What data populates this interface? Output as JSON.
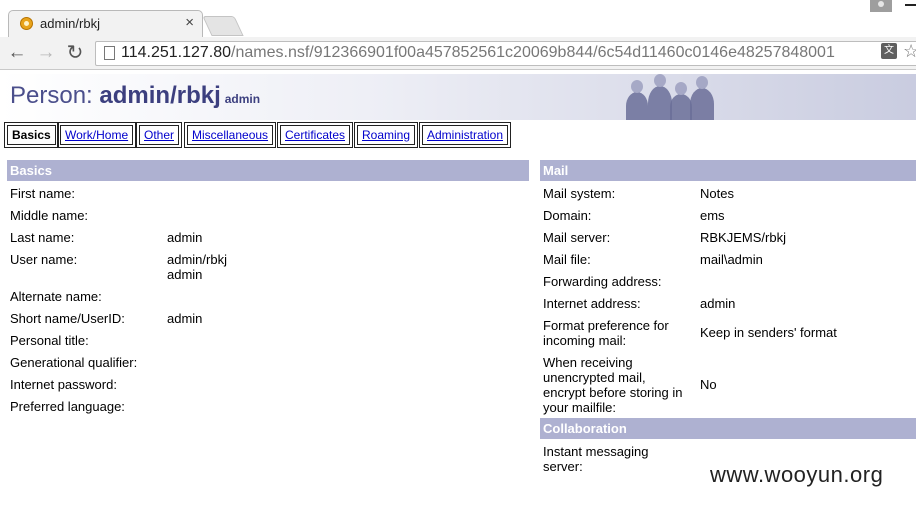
{
  "browser": {
    "tab_title": "admin/rbkj",
    "tab_close": "×",
    "url_host": "114.251.127.80",
    "url_path": "/names.nsf/912366901f00a457852561c20069b844/6c54d11460c0146e48257848001"
  },
  "header": {
    "prefix": "Person: ",
    "name": "admin/rbkj",
    "subtitle": "admin"
  },
  "tabs": [
    "Basics",
    "Work/Home",
    "Other",
    "Miscellaneous",
    "Certificates",
    "Roaming",
    "Administration"
  ],
  "basics": {
    "heading": "Basics",
    "fields": [
      {
        "label": "First name:",
        "value": ""
      },
      {
        "label": "Middle name:",
        "value": ""
      },
      {
        "label": "Last name:",
        "value": "admin"
      },
      {
        "label": "User name:",
        "value": "admin/rbkj",
        "value2": "admin"
      },
      {
        "label": "Alternate name:",
        "value": ""
      },
      {
        "label": "Short name/UserID:",
        "value": "admin"
      },
      {
        "label": "Personal title:",
        "value": ""
      },
      {
        "label": "Generational qualifier:",
        "value": ""
      },
      {
        "label": "Internet password:",
        "value": ""
      },
      {
        "label": "Preferred language:",
        "value": ""
      }
    ]
  },
  "mail": {
    "heading": "Mail",
    "fields": [
      {
        "label": "Mail system:",
        "value": "Notes"
      },
      {
        "label": "Domain:",
        "value": "ems"
      },
      {
        "label": "Mail server:",
        "value": "RBKJEMS/rbkj"
      },
      {
        "label": "Mail file:",
        "value": "mail\\admin"
      },
      {
        "label": "Forwarding address:",
        "value": ""
      },
      {
        "label": "Internet address:",
        "value": "admin"
      },
      {
        "label": "Format preference for",
        "label2": "incoming mail:",
        "value": "Keep in senders' format"
      },
      {
        "label": "When receiving",
        "label2": "unencrypted mail,",
        "label3": "encrypt before storing in",
        "label4": "your mailfile:",
        "value": "No"
      }
    ]
  },
  "collaboration": {
    "heading": "Collaboration",
    "fields": [
      {
        "label": "Instant messaging",
        "label2": "server:",
        "value": ""
      }
    ]
  },
  "watermark": "www.wooyun.org",
  "colors": {
    "section_header": "#aeb1d1",
    "title": "#4b4f8c",
    "link": "#0000cc"
  }
}
